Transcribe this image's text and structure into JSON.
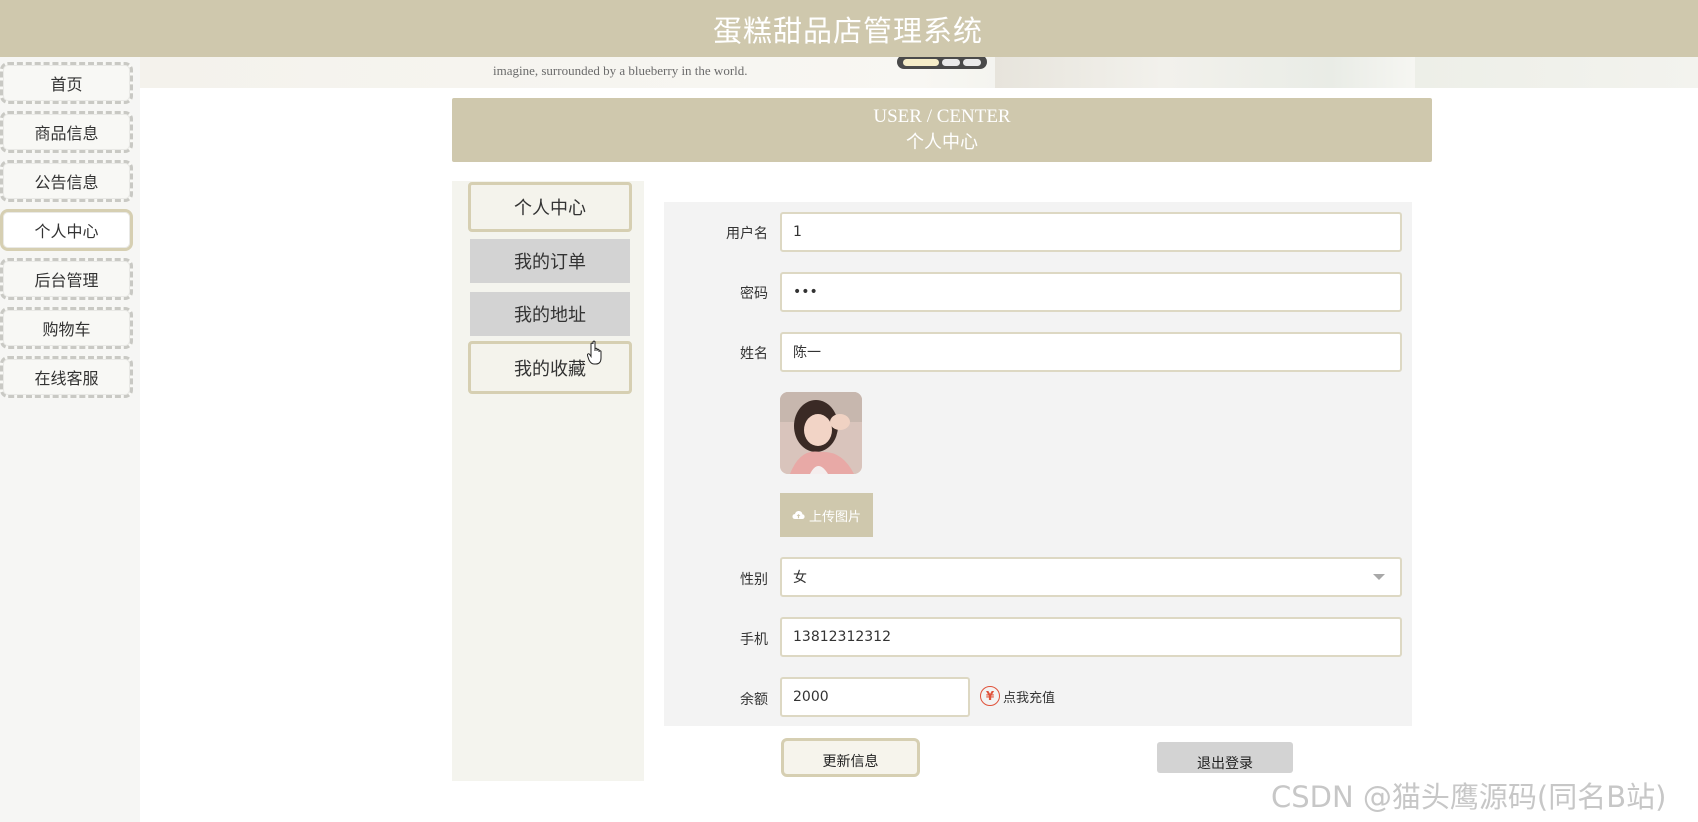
{
  "header": {
    "title": "蛋糕甜品店管理系统"
  },
  "banner": {
    "text": "imagine, surrounded by a blueberry in the world."
  },
  "sidebar": {
    "items": [
      {
        "label": "首页"
      },
      {
        "label": "商品信息"
      },
      {
        "label": "公告信息"
      },
      {
        "label": "个人中心",
        "active": true
      },
      {
        "label": "后台管理"
      },
      {
        "label": "购物车"
      },
      {
        "label": "在线客服"
      }
    ]
  },
  "section": {
    "title_en": "USER / CENTER",
    "title_cn": "个人中心"
  },
  "tabs": [
    {
      "label": "个人中心"
    },
    {
      "label": "我的订单"
    },
    {
      "label": "我的地址"
    },
    {
      "label": "我的收藏"
    }
  ],
  "form": {
    "username_label": "用户名",
    "username_value": "1",
    "password_label": "密码",
    "password_value": "123",
    "name_label": "姓名",
    "name_value": "陈一",
    "upload_label": "上传图片",
    "gender_label": "性别",
    "gender_value": "女",
    "phone_label": "手机",
    "phone_value": "13812312312",
    "balance_label": "余额",
    "balance_value": "2000",
    "recharge_label": "点我充值",
    "yen_symbol": "¥"
  },
  "actions": {
    "update_label": "更新信息",
    "logout_label": "退出登录"
  },
  "watermark": "CSDN @猫头鹰源码(同名B站)",
  "colors": {
    "theme": "#cfc8ad",
    "accent_border": "#d6cfb2",
    "recharge_icon": "#e0533b"
  }
}
